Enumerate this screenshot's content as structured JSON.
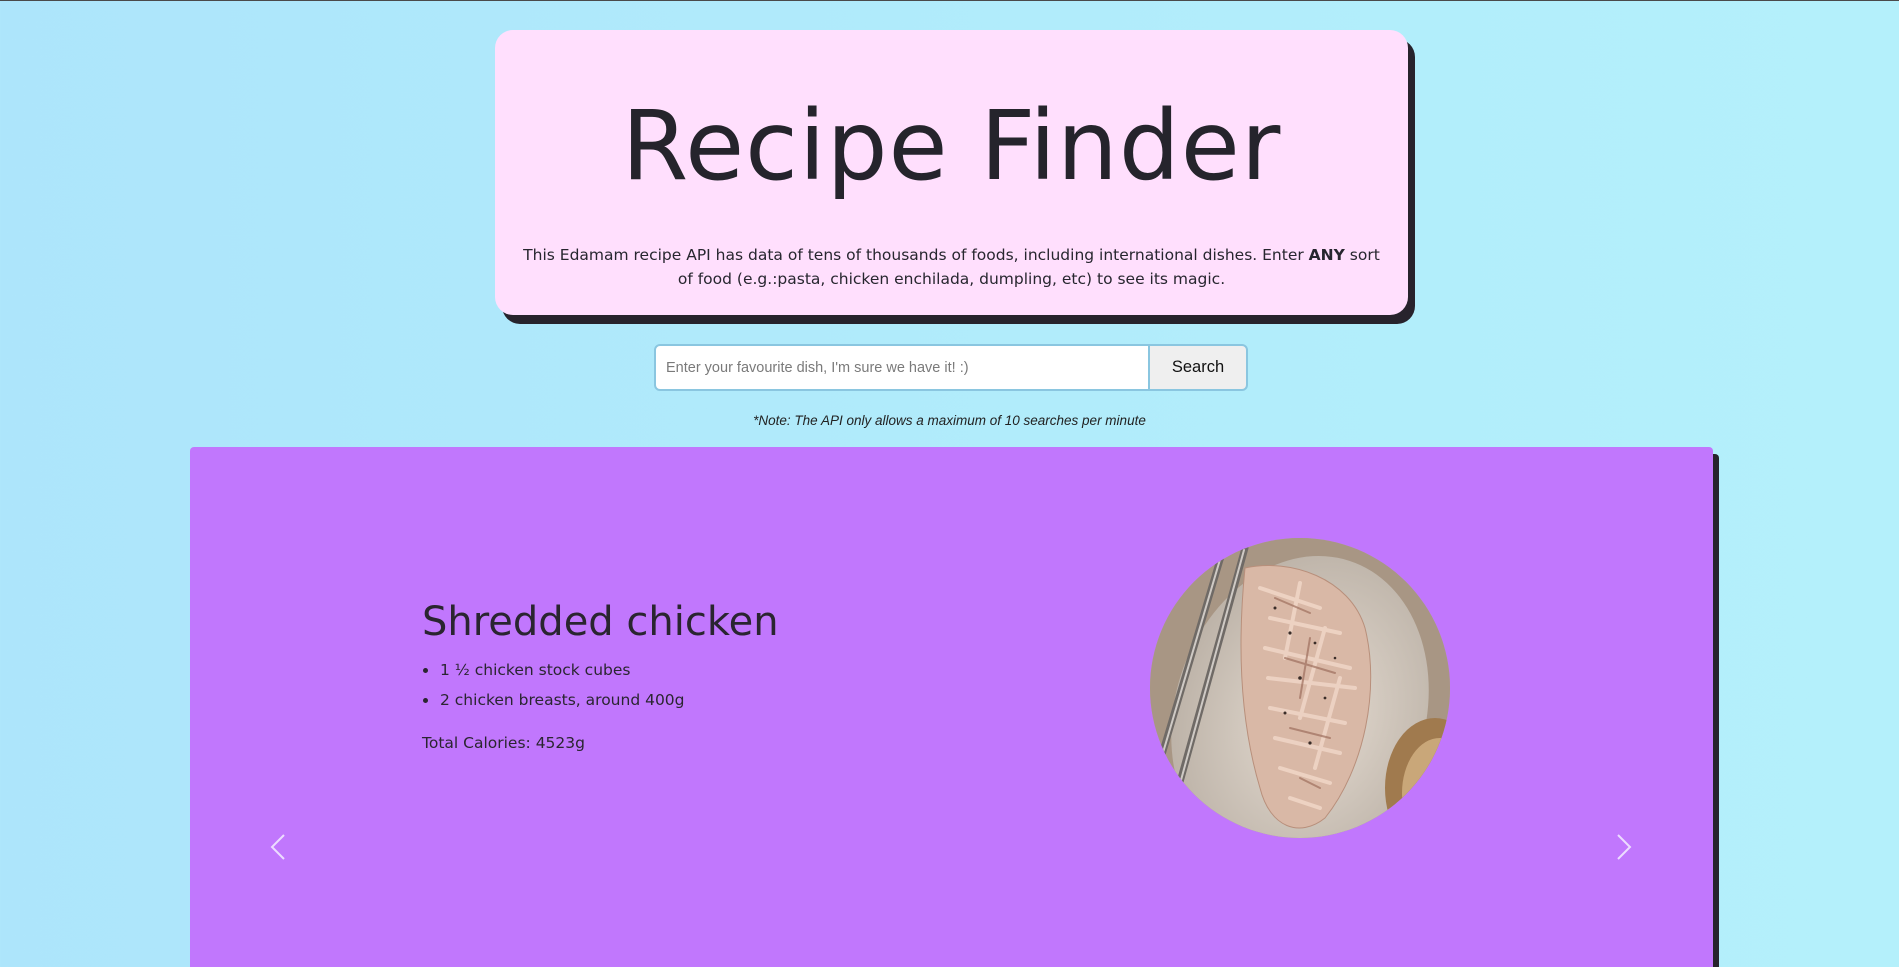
{
  "header": {
    "title": "Recipe Finder",
    "description_before": "This Edamam recipe API has data of tens of thousands of foods, including international dishes. Enter ",
    "description_bold": "ANY",
    "description_after": " sort of food (e.g.:pasta, chicken enchilada, dumpling, etc) to see its magic."
  },
  "search": {
    "placeholder": "Enter your favourite dish, I'm sure we have it! :)",
    "value": "",
    "button_label": "Search",
    "note": "*Note: The API only allows a maximum of 10 searches per minute"
  },
  "carousel": {
    "recipe": {
      "title": "Shredded chicken",
      "ingredients": [
        "1 ½ chicken stock cubes",
        "2 chicken breasts, around 400g"
      ],
      "calories_label": "Total Calories:",
      "calories_value": "4523g",
      "image_alt": "plate of shredded chicken with a fork"
    },
    "prev_icon": "chevron-left-icon",
    "next_icon": "chevron-right-icon"
  },
  "colors": {
    "background": "#b0eafb",
    "header_card": "#ffdffd",
    "carousel_bg": "#c177fd",
    "shadow": "#27232c",
    "text": "#25242c"
  }
}
